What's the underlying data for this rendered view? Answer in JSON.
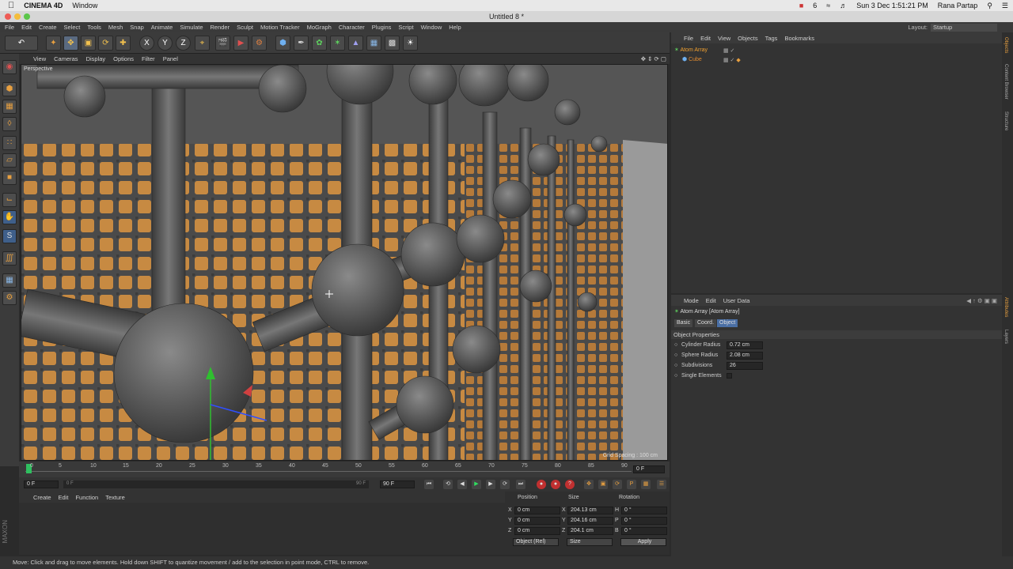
{
  "mac_menu": {
    "app_name": "CINEMA 4D",
    "window_menu": "Window",
    "status_number": "6",
    "date_time": "Sun 3 Dec  1:51:21 PM",
    "user": "Rana Partap"
  },
  "window": {
    "title": "Untitled 8 *"
  },
  "main_menu": [
    "File",
    "Edit",
    "Create",
    "Select",
    "Tools",
    "Mesh",
    "Snap",
    "Animate",
    "Simulate",
    "Render",
    "Sculpt",
    "Motion Tracker",
    "MoGraph",
    "Character",
    "Plugins",
    "Script",
    "Window",
    "Help"
  ],
  "layout": {
    "label": "Layout:",
    "value": "Startup"
  },
  "toolbar": {
    "x_label": "X",
    "y_label": "Y",
    "z_label": "Z"
  },
  "viewport": {
    "menu": [
      "View",
      "Cameras",
      "Display",
      "Options",
      "Filter",
      "Panel"
    ],
    "camera_label": "Perspective",
    "grid_spacing": "Grid Spacing : 100 cm"
  },
  "timeline": {
    "ticks": [
      "0",
      "5",
      "10",
      "15",
      "20",
      "25",
      "30",
      "35",
      "40",
      "45",
      "50",
      "55",
      "60",
      "65",
      "70",
      "75",
      "80",
      "85",
      "90"
    ],
    "current_frame": "0 F",
    "start_frame": "0 F",
    "slider_left": "0 F",
    "slider_right": "90 F",
    "end_frame": "90 F"
  },
  "material_manager": {
    "menu": [
      "Create",
      "Edit",
      "Function",
      "Texture"
    ]
  },
  "coordinates": {
    "headers": {
      "position": "Position",
      "size": "Size",
      "rotation": "Rotation"
    },
    "rows": [
      {
        "axis": "X",
        "pos": "0 cm",
        "size_axis": "X",
        "size": "204.13 cm",
        "rot_axis": "H",
        "rot": "0 °"
      },
      {
        "axis": "Y",
        "pos": "0 cm",
        "size_axis": "Y",
        "size": "204.16 cm",
        "rot_axis": "P",
        "rot": "0 °"
      },
      {
        "axis": "Z",
        "pos": "0 cm",
        "size_axis": "Z",
        "size": "204.1 cm",
        "rot_axis": "B",
        "rot": "0 °"
      }
    ],
    "mode_select": "Object (Rel)",
    "size_select": "Size",
    "apply": "Apply"
  },
  "object_manager": {
    "menu": [
      "File",
      "Edit",
      "View",
      "Objects",
      "Tags",
      "Bookmarks"
    ],
    "objects": [
      {
        "name": "Atom Array",
        "color": "#f0a030"
      },
      {
        "name": "Cube",
        "color": "#e08a30"
      }
    ]
  },
  "attribute_manager": {
    "menu": [
      "Mode",
      "Edit",
      "User Data"
    ],
    "object_title": "Atom Array [Atom Array]",
    "tabs": [
      "Basic",
      "Coord.",
      "Object"
    ],
    "section": "Object Properties",
    "properties": [
      {
        "label": "Cylinder Radius",
        "value": "0.72 cm"
      },
      {
        "label": "Sphere Radius",
        "value": "2.08 cm"
      },
      {
        "label": "Subdivisions",
        "value": "26"
      },
      {
        "label": "Single Elements",
        "value": ""
      }
    ]
  },
  "side_tabs": [
    "Objects",
    "Content Browser",
    "Structure",
    "Attributes",
    "Layers"
  ],
  "status_bar": "Move: Click and drag to move elements. Hold down SHIFT to quantize movement / add to the selection in point mode, CTRL to remove.",
  "colors": {
    "accent": "#e8a040",
    "selected": "#4a6fa5",
    "bg": "#2b2b2b"
  }
}
